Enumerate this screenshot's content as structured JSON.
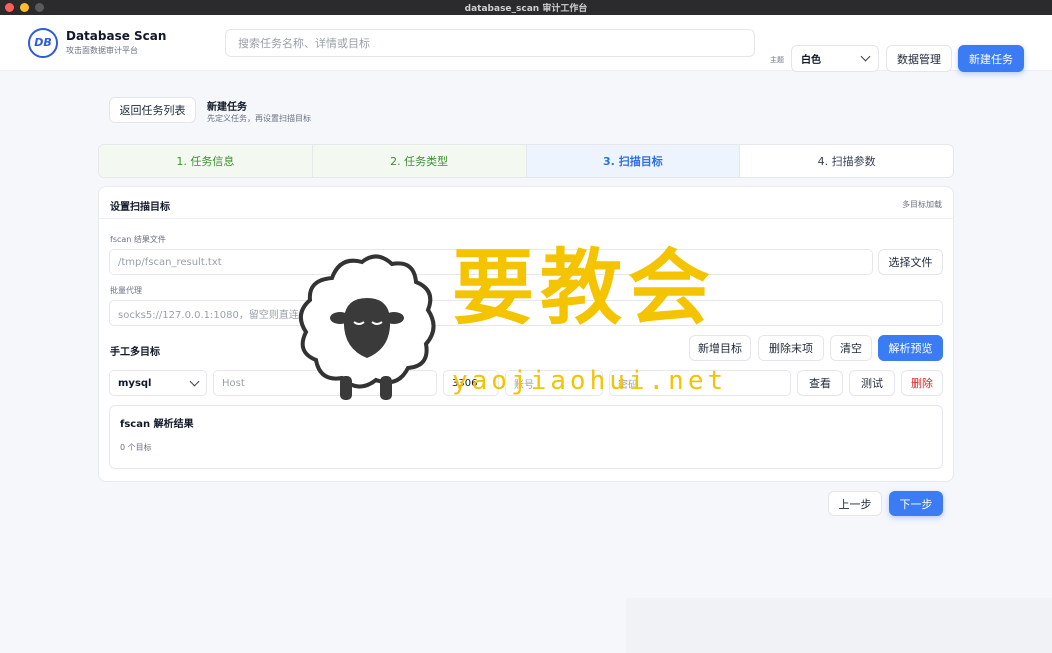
{
  "window": {
    "title": "database_scan 审计工作台"
  },
  "header": {
    "logo_text": "DB",
    "brand_name": "Database Scan",
    "brand_sub": "攻击面数据审计平台",
    "search_placeholder": "搜索任务名称、详情或目标",
    "theme_label": "主题",
    "theme_value": "白色",
    "data_manage": "数据管理",
    "new_task": "新建任务"
  },
  "page": {
    "back": "返回任务列表",
    "title": "新建任务",
    "subtitle": "先定义任务，再设置扫描目标"
  },
  "steps": [
    {
      "label": "1. 任务信息",
      "state": "done"
    },
    {
      "label": "2. 任务类型",
      "state": "done"
    },
    {
      "label": "3. 扫描目标",
      "state": "active"
    },
    {
      "label": "4. 扫描参数",
      "state": "todo"
    }
  ],
  "card": {
    "title": "设置扫描目标",
    "multi_load": "多目标加载",
    "fscan_label": "fscan 结果文件",
    "fscan_value": "/tmp/fscan_result.txt",
    "choose_file": "选择文件",
    "proxy_label": "批量代理",
    "proxy_placeholder": "socks5://127.0.0.1:1080，留空则直连",
    "manual_title": "手工多目标",
    "add_target": "新增目标",
    "remove_last": "删除末项",
    "clear": "清空",
    "parse_preview": "解析预览",
    "row": {
      "db": "mysql",
      "host_placeholder": "Host",
      "port": "3306",
      "user_placeholder": "账号",
      "pass_placeholder": "密码",
      "view": "查看",
      "test": "测试",
      "delete": "删除"
    },
    "result_title": "fscan 解析结果",
    "result_count": "0 个目标"
  },
  "footer": {
    "prev": "上一步",
    "next": "下一步"
  },
  "watermark": {
    "text": "要教会",
    "url": "yaojiaohui.net"
  },
  "colors": {
    "primary": "#3b7cf5",
    "done": "#3f8f35",
    "watermark": "#f5c400",
    "danger": "#dc2626"
  }
}
